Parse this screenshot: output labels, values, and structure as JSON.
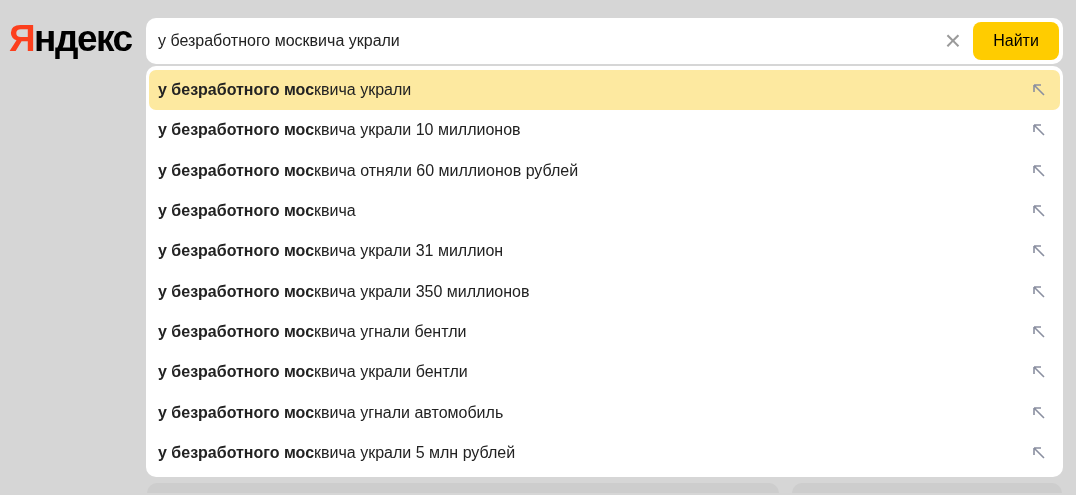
{
  "logo": {
    "accent": "Я",
    "rest": "ндекс"
  },
  "search": {
    "value": "у безработного москвича украли",
    "clear": "×",
    "button": "Найти"
  },
  "suggestions": [
    {
      "text": "**у безработного мос**квича украли",
      "selected": true
    },
    {
      "text": "**у безработного мос**квича украли 10 миллионов",
      "selected": false
    },
    {
      "text": "**у безработного мос**квича отняли 60 миллионов рублей",
      "selected": false
    },
    {
      "text": "**у безработного мос**квича",
      "selected": false
    },
    {
      "text": "**у безработного мос**квича украли 31 миллион",
      "selected": false
    },
    {
      "text": "**у безработного мос**квича украли 350 миллионов",
      "selected": false
    },
    {
      "text": "**у безработного мос**квича угнали бентли",
      "selected": false
    },
    {
      "text": "**у безработного мос**квича украли бентли",
      "selected": false
    },
    {
      "text": "**у безработного мос**квича угнали автомобиль",
      "selected": false
    },
    {
      "text": "**у безработного мос**квича украли 5 млн рублей",
      "selected": false
    }
  ]
}
